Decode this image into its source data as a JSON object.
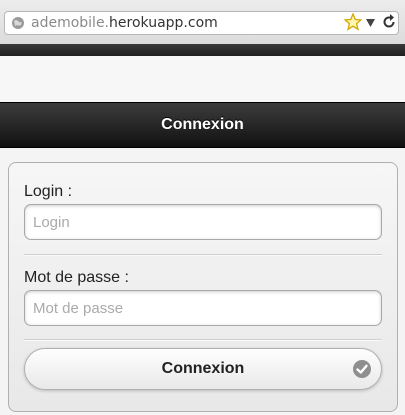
{
  "browser": {
    "url_dim_prefix": "ademobile.",
    "url_main": "herokuapp.com",
    "icons": [
      "globe-icon",
      "star-icon",
      "chevron-down-icon",
      "reload-icon"
    ]
  },
  "header": {
    "title": "Connexion"
  },
  "form": {
    "login_label": "Login :",
    "login_placeholder": "Login",
    "password_label": "Mot de passe :",
    "password_placeholder": "Mot de passe",
    "submit_label": "Connexion",
    "submit_icon": "check-circle-icon"
  },
  "colors": {
    "header_bg": "#1a1a1a",
    "star": "#f4c400"
  }
}
